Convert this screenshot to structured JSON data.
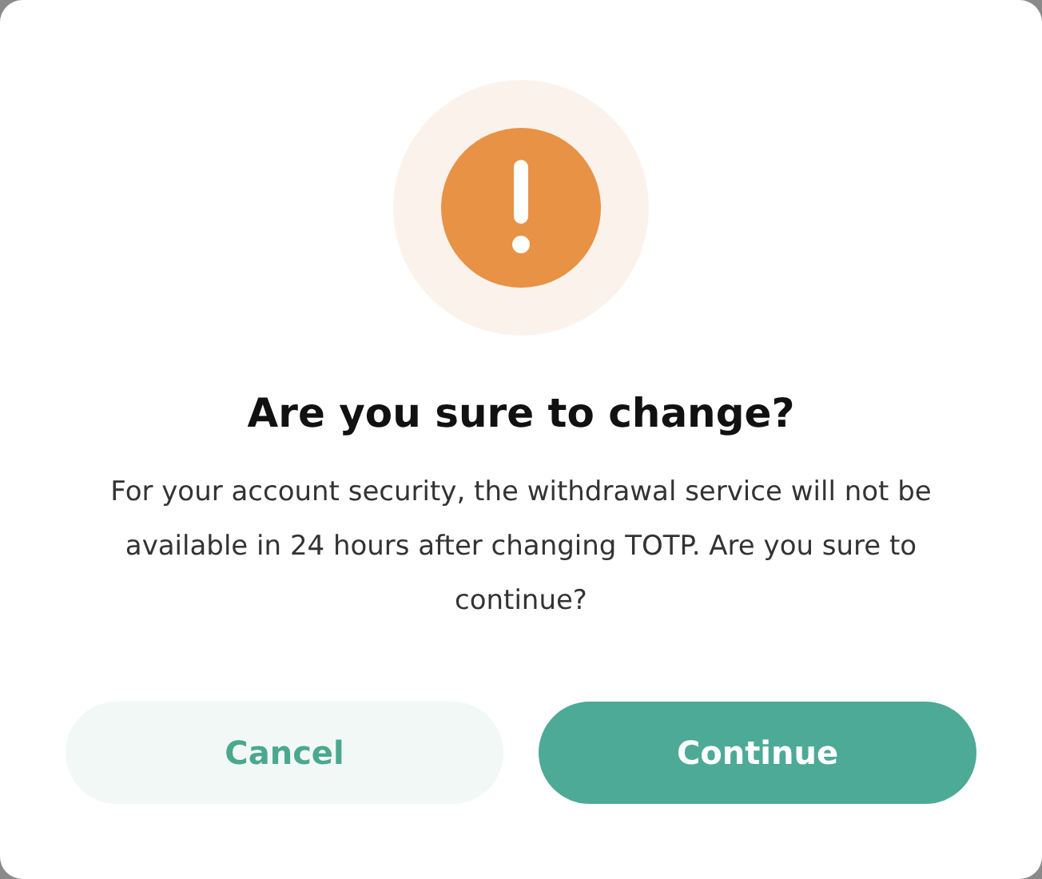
{
  "dialog": {
    "title": "Are you sure to change?",
    "message": "For your account security, the withdrawal service will not be available in 24 hours after changing TOTP. Are you sure to continue?",
    "buttons": [
      {
        "label": "Cancel",
        "kind": "secondary"
      },
      {
        "label": "Continue",
        "kind": "primary"
      }
    ]
  }
}
